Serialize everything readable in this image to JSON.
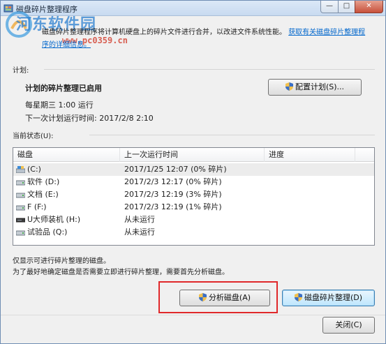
{
  "window": {
    "title": "磁盘碎片整理程序",
    "controls": {
      "minimize": "—",
      "maximize": "□",
      "close": "✕"
    }
  },
  "watermark": {
    "text": "河东软件园",
    "url": "www.pc0359.cn"
  },
  "description": {
    "text": "磁盘碎片整理程序将计算机硬盘上的碎片文件进行合并，以改进文件系统性能。",
    "link1": "获取有关磁盘碎片整理程",
    "link2": "序的详细信息。"
  },
  "schedule": {
    "section_label": "计划:",
    "status_title": "计划的碎片整理已启用",
    "frequency": "每星期三 1:00 运行",
    "next_run": "下一次计划运行时间: 2017/2/8 2:10",
    "configure_button": "配置计划(S)..."
  },
  "current_status": {
    "section_label": "当前状态(U):",
    "columns": [
      "磁盘",
      "上一次运行时间",
      "进度"
    ],
    "rows": [
      {
        "disk": "(C:)",
        "last_run": "2017/1/25 12:07 (0% 碎片)",
        "progress": "",
        "icon": "system-drive-icon"
      },
      {
        "disk": "软件 (D:)",
        "last_run": "2017/2/3 12:17 (0% 碎片)",
        "progress": "",
        "icon": "hard-drive-icon"
      },
      {
        "disk": "文档 (E:)",
        "last_run": "2017/2/3 12:19 (3% 碎片)",
        "progress": "",
        "icon": "hard-drive-icon"
      },
      {
        "disk": "F (F:)",
        "last_run": "2017/2/3 12:19 (1% 碎片)",
        "progress": "",
        "icon": "hard-drive-icon"
      },
      {
        "disk": "U大师装机 (H:)",
        "last_run": "从未运行",
        "progress": "",
        "icon": "usb-drive-icon"
      },
      {
        "disk": "试验品 (Q:)",
        "last_run": "从未运行",
        "progress": "",
        "icon": "hard-drive-icon"
      }
    ]
  },
  "notes": {
    "line1": "仅显示可进行碎片整理的磁盘。",
    "line2": "为了最好地确定磁盘是否需要立即进行碎片整理，需要首先分析磁盘。"
  },
  "buttons": {
    "analyze": "分析磁盘(A)",
    "defragment": "磁盘碎片整理(D)",
    "close": "关闭(C)"
  },
  "colors": {
    "link": "#0066cc",
    "highlight_box": "#e0282a",
    "titlebar": "#c8daf0"
  }
}
